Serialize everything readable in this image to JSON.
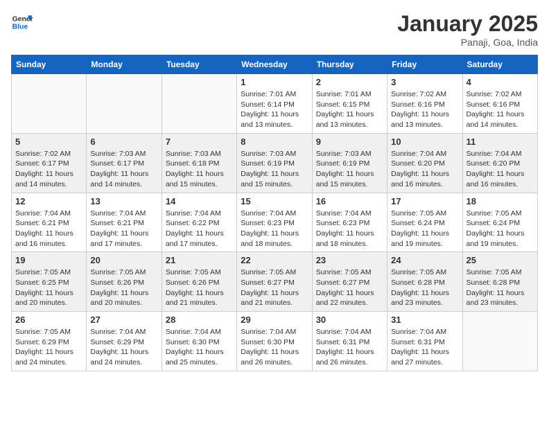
{
  "header": {
    "logo_line1": "General",
    "logo_line2": "Blue",
    "month": "January 2025",
    "location": "Panaji, Goa, India"
  },
  "days_of_week": [
    "Sunday",
    "Monday",
    "Tuesday",
    "Wednesday",
    "Thursday",
    "Friday",
    "Saturday"
  ],
  "weeks": [
    [
      {
        "day": "",
        "info": ""
      },
      {
        "day": "",
        "info": ""
      },
      {
        "day": "",
        "info": ""
      },
      {
        "day": "1",
        "info": "Sunrise: 7:01 AM\nSunset: 6:14 PM\nDaylight: 11 hours\nand 13 minutes."
      },
      {
        "day": "2",
        "info": "Sunrise: 7:01 AM\nSunset: 6:15 PM\nDaylight: 11 hours\nand 13 minutes."
      },
      {
        "day": "3",
        "info": "Sunrise: 7:02 AM\nSunset: 6:16 PM\nDaylight: 11 hours\nand 13 minutes."
      },
      {
        "day": "4",
        "info": "Sunrise: 7:02 AM\nSunset: 6:16 PM\nDaylight: 11 hours\nand 14 minutes."
      }
    ],
    [
      {
        "day": "5",
        "info": "Sunrise: 7:02 AM\nSunset: 6:17 PM\nDaylight: 11 hours\nand 14 minutes."
      },
      {
        "day": "6",
        "info": "Sunrise: 7:03 AM\nSunset: 6:17 PM\nDaylight: 11 hours\nand 14 minutes."
      },
      {
        "day": "7",
        "info": "Sunrise: 7:03 AM\nSunset: 6:18 PM\nDaylight: 11 hours\nand 15 minutes."
      },
      {
        "day": "8",
        "info": "Sunrise: 7:03 AM\nSunset: 6:19 PM\nDaylight: 11 hours\nand 15 minutes."
      },
      {
        "day": "9",
        "info": "Sunrise: 7:03 AM\nSunset: 6:19 PM\nDaylight: 11 hours\nand 15 minutes."
      },
      {
        "day": "10",
        "info": "Sunrise: 7:04 AM\nSunset: 6:20 PM\nDaylight: 11 hours\nand 16 minutes."
      },
      {
        "day": "11",
        "info": "Sunrise: 7:04 AM\nSunset: 6:20 PM\nDaylight: 11 hours\nand 16 minutes."
      }
    ],
    [
      {
        "day": "12",
        "info": "Sunrise: 7:04 AM\nSunset: 6:21 PM\nDaylight: 11 hours\nand 16 minutes."
      },
      {
        "day": "13",
        "info": "Sunrise: 7:04 AM\nSunset: 6:21 PM\nDaylight: 11 hours\nand 17 minutes."
      },
      {
        "day": "14",
        "info": "Sunrise: 7:04 AM\nSunset: 6:22 PM\nDaylight: 11 hours\nand 17 minutes."
      },
      {
        "day": "15",
        "info": "Sunrise: 7:04 AM\nSunset: 6:23 PM\nDaylight: 11 hours\nand 18 minutes."
      },
      {
        "day": "16",
        "info": "Sunrise: 7:04 AM\nSunset: 6:23 PM\nDaylight: 11 hours\nand 18 minutes."
      },
      {
        "day": "17",
        "info": "Sunrise: 7:05 AM\nSunset: 6:24 PM\nDaylight: 11 hours\nand 19 minutes."
      },
      {
        "day": "18",
        "info": "Sunrise: 7:05 AM\nSunset: 6:24 PM\nDaylight: 11 hours\nand 19 minutes."
      }
    ],
    [
      {
        "day": "19",
        "info": "Sunrise: 7:05 AM\nSunset: 6:25 PM\nDaylight: 11 hours\nand 20 minutes."
      },
      {
        "day": "20",
        "info": "Sunrise: 7:05 AM\nSunset: 6:26 PM\nDaylight: 11 hours\nand 20 minutes."
      },
      {
        "day": "21",
        "info": "Sunrise: 7:05 AM\nSunset: 6:26 PM\nDaylight: 11 hours\nand 21 minutes."
      },
      {
        "day": "22",
        "info": "Sunrise: 7:05 AM\nSunset: 6:27 PM\nDaylight: 11 hours\nand 21 minutes."
      },
      {
        "day": "23",
        "info": "Sunrise: 7:05 AM\nSunset: 6:27 PM\nDaylight: 11 hours\nand 22 minutes."
      },
      {
        "day": "24",
        "info": "Sunrise: 7:05 AM\nSunset: 6:28 PM\nDaylight: 11 hours\nand 23 minutes."
      },
      {
        "day": "25",
        "info": "Sunrise: 7:05 AM\nSunset: 6:28 PM\nDaylight: 11 hours\nand 23 minutes."
      }
    ],
    [
      {
        "day": "26",
        "info": "Sunrise: 7:05 AM\nSunset: 6:29 PM\nDaylight: 11 hours\nand 24 minutes."
      },
      {
        "day": "27",
        "info": "Sunrise: 7:04 AM\nSunset: 6:29 PM\nDaylight: 11 hours\nand 24 minutes."
      },
      {
        "day": "28",
        "info": "Sunrise: 7:04 AM\nSunset: 6:30 PM\nDaylight: 11 hours\nand 25 minutes."
      },
      {
        "day": "29",
        "info": "Sunrise: 7:04 AM\nSunset: 6:30 PM\nDaylight: 11 hours\nand 26 minutes."
      },
      {
        "day": "30",
        "info": "Sunrise: 7:04 AM\nSunset: 6:31 PM\nDaylight: 11 hours\nand 26 minutes."
      },
      {
        "day": "31",
        "info": "Sunrise: 7:04 AM\nSunset: 6:31 PM\nDaylight: 11 hours\nand 27 minutes."
      },
      {
        "day": "",
        "info": ""
      }
    ]
  ]
}
